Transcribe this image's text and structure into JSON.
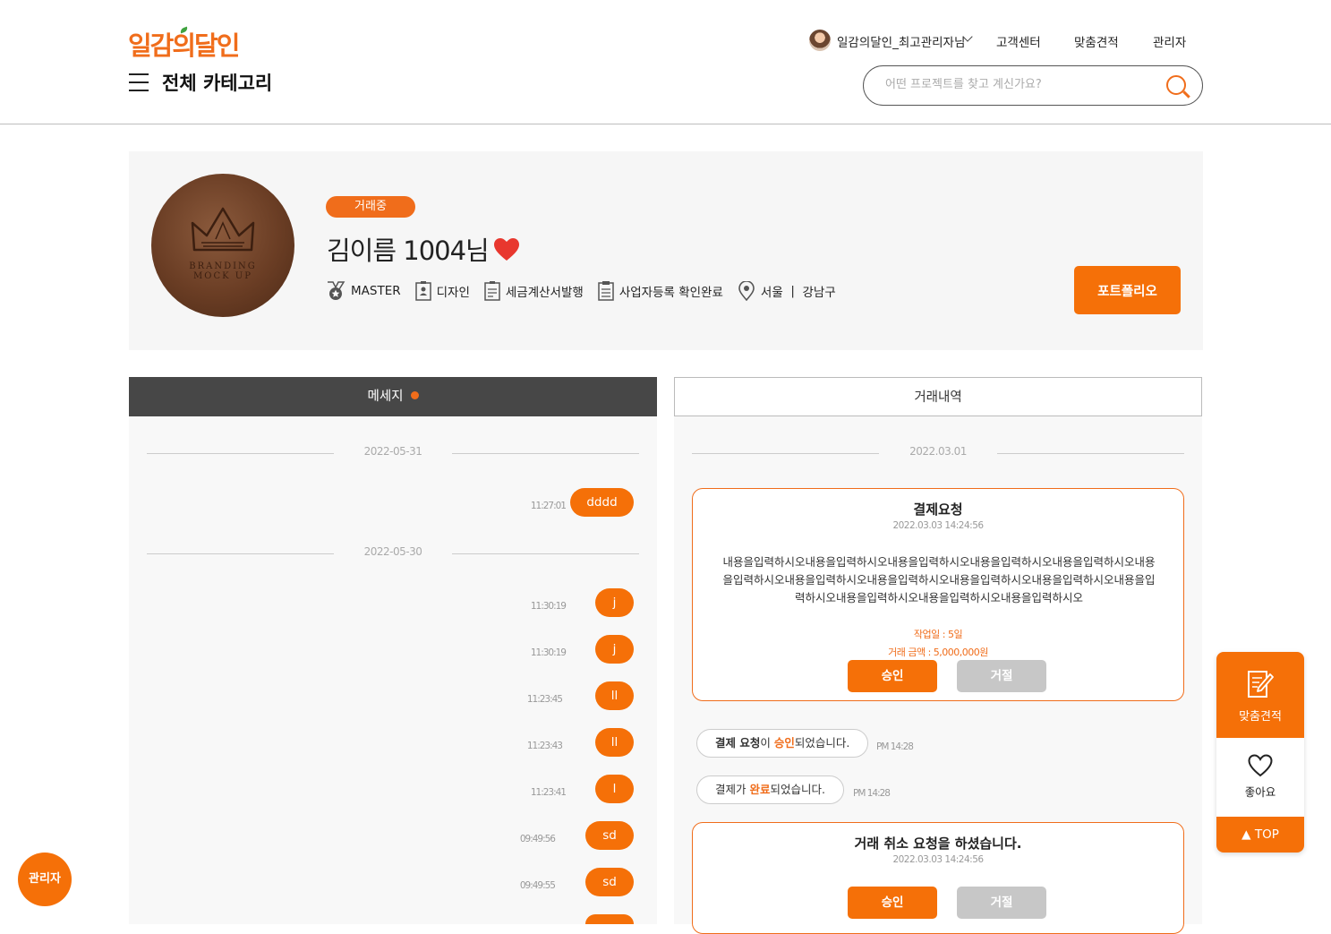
{
  "header": {
    "logo": "일감의달인",
    "category_label": "전체 카테고리",
    "user_name": "일감의달인_최고관리자님",
    "nav": [
      "고객센터",
      "맞춤견적",
      "관리자"
    ],
    "search_placeholder": "어떤 프로젝트를 찾고 계신가요?"
  },
  "profile": {
    "image_text_line1": "BRANDING",
    "image_text_line2": "MOCK UP",
    "status_badge": "거래중",
    "name": "김이름 1004님",
    "tags": {
      "grade": "MASTER",
      "field": "디자인",
      "tax": "세금계산서발행",
      "business": "사업자등록 확인완료",
      "city": "서울",
      "separator": "|",
      "district": "강남구"
    },
    "portfolio_button": "포트폴리오"
  },
  "messages": {
    "tab_label": "메세지",
    "groups": [
      {
        "date": "2022-05-31",
        "items": [
          {
            "time": "11:27:01",
            "text": "dddd"
          }
        ]
      },
      {
        "date": "2022-05-30",
        "items": [
          {
            "time": "11:30:19",
            "text": "j"
          },
          {
            "time": "11:30:19",
            "text": "j"
          },
          {
            "time": "11:23:45",
            "text": "ll"
          },
          {
            "time": "11:23:43",
            "text": "ll"
          },
          {
            "time": "11:23:41",
            "text": "l"
          },
          {
            "time": "09:49:56",
            "text": "sd"
          },
          {
            "time": "09:49:55",
            "text": "sd"
          }
        ]
      }
    ]
  },
  "deals": {
    "tab_label": "거래내역",
    "date": "2022.03.01",
    "payment_card": {
      "title": "결제요청",
      "datetime": "2022.03.03 14:24:56",
      "body_lines": [
        "내용을입력하시오내용을입력하시오내용을입력하시오내용을입력하시오내용을입력하시오내용",
        "을입력하시오내용을입력하시오내용을입력하시오내용을입력하시오내용을입력하시오내용을입",
        "력하시오내용을입력하시오내용을입력하시오내용을입력하시오"
      ],
      "work_days": "작업일 : 5일",
      "amount": "거래 금액 : 5,000,000원",
      "approve": "승인",
      "reject": "거절"
    },
    "status1": {
      "pre": "결제 요청",
      "mid": "이 ",
      "hl": "승인",
      "post": "되었습니다.",
      "time": "PM 14:28"
    },
    "status2": {
      "pre": "결제가 ",
      "hl": "완료",
      "post": "되었습니다.",
      "time": "PM 14:28"
    },
    "cancel_card": {
      "title": "거래 취소 요청을 하셨습니다.",
      "datetime": "2022.03.03 14:24:56",
      "approve": "승인",
      "reject": "거절"
    }
  },
  "side": {
    "quote": "맞춤견적",
    "like": "좋아요",
    "top": "▲ TOP"
  },
  "admin_fab": "관리자",
  "colors": {
    "accent": "#f57008",
    "dark_tab": "#474747",
    "heart": "#e8372e"
  }
}
